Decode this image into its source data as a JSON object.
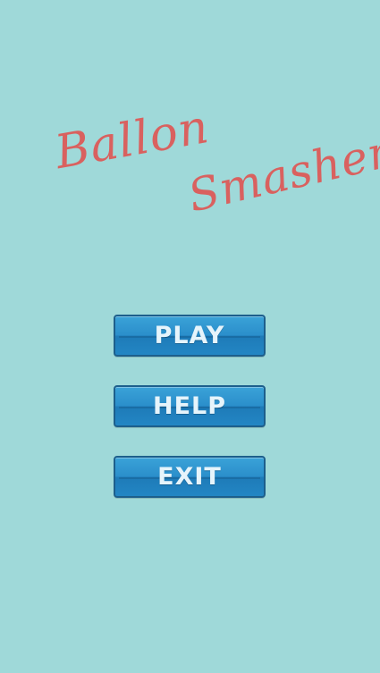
{
  "title": {
    "line1": "Ballon",
    "line2": "Smasher"
  },
  "menu": {
    "play_label": "PLAY",
    "help_label": "HELP",
    "exit_label": "EXIT"
  },
  "colors": {
    "background": "#9fd9d9",
    "title": "#d9615f",
    "button": "#2b8fcb",
    "button_text": "#e6f4fb"
  }
}
